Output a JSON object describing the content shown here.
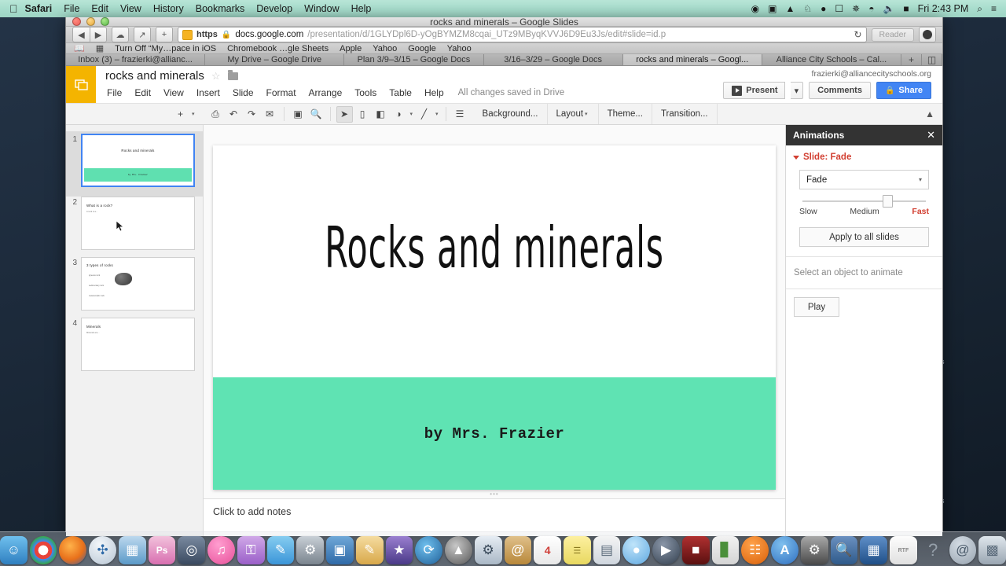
{
  "menubar": {
    "apple_icon": "apple-icon",
    "items": [
      {
        "label": "Safari",
        "bold": true
      },
      {
        "label": "File",
        "bold": false
      },
      {
        "label": "Edit",
        "bold": false
      },
      {
        "label": "View",
        "bold": false
      },
      {
        "label": "History",
        "bold": false
      },
      {
        "label": "Bookmarks",
        "bold": false
      },
      {
        "label": "Develop",
        "bold": false
      },
      {
        "label": "Window",
        "bold": false
      },
      {
        "label": "Help",
        "bold": false
      }
    ],
    "status_icons": [
      "record-icon",
      "screen-share-icon",
      "airdrop-icon",
      "evernote-icon",
      "app-icon",
      "airplay-icon",
      "bluetooth-icon",
      "wifi-icon",
      "volume-icon",
      "battery-icon"
    ],
    "clock": "Fri 2:43 PM",
    "spotlight_icon": "search-icon",
    "notifications_icon": "notification-center-icon"
  },
  "window": {
    "title": "rocks and minerals – Google Slides"
  },
  "browser": {
    "back_icon": "back-arrow-icon",
    "forward_icon": "forward-arrow-icon",
    "icloud_icon": "icloud-tabs-icon",
    "share_icon": "share-icon",
    "newtab_icon": "plus-icon",
    "url": {
      "scheme_label": "https",
      "lock_icon": "lock-icon",
      "host": "docs.google.com",
      "path": "/presentation/d/1GLYDpl6D-yOgBYMZM8cqai_UTz9MByqKVVJ6D9Eu3Js/edit#slide=id.p"
    },
    "reload_icon": "reload-icon",
    "reader_label": "Reader",
    "downloads_icon": "downloads-icon",
    "bookmarks": {
      "reading_list_icon": "reading-list-icon",
      "top_sites_icon": "top-sites-icon",
      "items": [
        "Turn Off “My…pace in iOS",
        "Chromebook …gle Sheets",
        "Apple",
        "Yahoo",
        "Google",
        "Yahoo"
      ]
    },
    "tabs": [
      {
        "label": "Inbox (3) – frazierki@allianc...",
        "active": false
      },
      {
        "label": "My Drive – Google Drive",
        "active": false
      },
      {
        "label": "Plan 3/9–3/15 – Google Docs",
        "active": false
      },
      {
        "label": "3/16–3/29 – Google Docs",
        "active": false
      },
      {
        "label": "rocks and minerals – Googl...",
        "active": true
      },
      {
        "label": "Alliance City Schools – Cal...",
        "active": false
      }
    ],
    "new_tab_icon": "plus-icon",
    "show_all_tabs_icon": "show-all-tabs-icon"
  },
  "slides": {
    "app_logo_icon": "google-slides-icon",
    "doc_title": "rocks and minerals",
    "star_icon": "star-icon",
    "folder_icon": "folder-icon",
    "menus": [
      "File",
      "Edit",
      "View",
      "Insert",
      "Slide",
      "Format",
      "Arrange",
      "Tools",
      "Table",
      "Help"
    ],
    "save_status": "All changes saved in Drive",
    "account": "frazierki@alliancecityschools.org",
    "present_label": "Present",
    "comments_label": "Comments",
    "share_label": "Share",
    "toolbar": {
      "new_slide_icon": "plus-icon",
      "print_icon": "print-icon",
      "undo_icon": "undo-icon",
      "redo_icon": "redo-icon",
      "paint_format_icon": "paint-format-icon",
      "fit_icon": "fit-to-window-icon",
      "zoom_icon": "zoom-icon",
      "select_icon": "select-arrow-icon",
      "textbox_icon": "text-box-icon",
      "image_icon": "image-icon",
      "shape_icon": "shape-icon",
      "line_icon": "line-icon",
      "layout_icon": "layout-icon",
      "background_label": "Background...",
      "layout_label": "Layout",
      "theme_label": "Theme...",
      "transition_label": "Transition...",
      "collapse_icon": "collapse-chevron-icon"
    },
    "filmstrip": [
      {
        "number": "1",
        "title": "Rocks and minerals",
        "band_text": "by Mrs. Frazier",
        "active": true
      },
      {
        "number": "2",
        "title": "What is a rock?",
        "subtitle": "A rock is a...",
        "active": false
      },
      {
        "number": "3",
        "title": "3 types of rocks",
        "bullets": [
          "igneous rock",
          "sedimentary rock",
          "metamorphic rock"
        ],
        "active": false
      },
      {
        "number": "4",
        "title": "Minerals",
        "subtitle": "Minerals are...",
        "active": false
      }
    ],
    "canvas": {
      "slide_title": "Rocks and minerals",
      "slide_subtitle": "by Mrs. Frazier",
      "band_color": "#5fe3b3"
    },
    "notes_placeholder": "Click to add notes"
  },
  "animations": {
    "panel_title": "Animations",
    "close_icon": "close-icon",
    "slide_section_label": "Slide: Fade",
    "effect_value": "Fade",
    "dropdown_icon": "chevron-down-icon",
    "speed_labels": {
      "slow": "Slow",
      "medium": "Medium",
      "fast": "Fast"
    },
    "speed_value": "Fast",
    "apply_all_label": "Apply to all slides",
    "empty_message": "Select an object to animate",
    "play_label": "Play",
    "accent_color": "#d23f31"
  },
  "dock": {
    "items": [
      {
        "name": "finder",
        "glyph": "🙂",
        "color": "#3b9ae1"
      },
      {
        "name": "chrome",
        "glyph": "◉",
        "color": "#ffffff"
      },
      {
        "name": "firefox",
        "glyph": "◐",
        "color": "#e8701a"
      },
      {
        "name": "safari",
        "glyph": "✴",
        "color": "#d8dde2"
      },
      {
        "name": "launchpad",
        "glyph": "▒",
        "color": "#8fb9d9"
      },
      {
        "name": "photoshop",
        "glyph": "Ps",
        "color": "#d86fb0"
      },
      {
        "name": "photo-booth",
        "glyph": "◎",
        "color": "#4a5a73"
      },
      {
        "name": "itunes",
        "glyph": "♫",
        "color": "#f06eb0"
      },
      {
        "name": "keychain",
        "glyph": "⚿",
        "color": "#b06fd8"
      },
      {
        "name": "notes-app",
        "glyph": "✎",
        "color": "#5bb3e8"
      },
      {
        "name": "system-prefs-old",
        "glyph": "⚙",
        "color": "#9aa3ad"
      },
      {
        "name": "keynote",
        "glyph": "▣",
        "color": "#3b7fc4"
      },
      {
        "name": "pages",
        "glyph": "✍",
        "color": "#e8b84a"
      },
      {
        "name": "imovie",
        "glyph": "★",
        "color": "#6a4fa8"
      },
      {
        "name": "time-machine",
        "glyph": "⟳",
        "color": "#2f7fb8"
      },
      {
        "name": "rocket",
        "glyph": "↑",
        "color": "#6e6e6e"
      },
      {
        "name": "preview",
        "glyph": "⚑",
        "color": "#c8d4e0"
      },
      {
        "name": "contacts",
        "glyph": "@",
        "color": "#c79a52"
      },
      {
        "name": "calendar",
        "glyph": "4",
        "color": "#ffffff"
      },
      {
        "name": "stickies",
        "glyph": "☰",
        "color": "#f2e06a"
      },
      {
        "name": "dictionary",
        "glyph": "▤",
        "color": "#e3e3e3"
      },
      {
        "name": "messages",
        "glyph": "●",
        "color": "#7fc4f0"
      },
      {
        "name": "facetime",
        "glyph": "▶",
        "color": "#4a5a73"
      },
      {
        "name": "final-cut",
        "glyph": "■",
        "color": "#8a2020"
      },
      {
        "name": "numbers",
        "glyph": "▐",
        "color": "#5fb84a"
      },
      {
        "name": "ibooks",
        "glyph": "◗",
        "color": "#e8751a"
      },
      {
        "name": "app-store",
        "glyph": "A",
        "color": "#3b8fd8"
      },
      {
        "name": "system-preferences",
        "glyph": "⚙",
        "color": "#6a6a6a"
      },
      {
        "name": "finder-folder",
        "glyph": "🔍",
        "color": "#3b6ea8"
      },
      {
        "name": "downloads-folder",
        "glyph": "▦",
        "color": "#2f6aa8"
      },
      {
        "name": "rtf-document",
        "glyph": "RTF",
        "color": "#f4f4f4"
      },
      {
        "name": "help-question",
        "glyph": "?",
        "color": "#555f6a"
      },
      {
        "name": "at-icon",
        "glyph": "@",
        "color": "#aab4be"
      },
      {
        "name": "trash",
        "glyph": "▥",
        "color": "#c8d0d8"
      }
    ]
  },
  "desktop": {
    "partial_labels": [
      "s",
      "s"
    ]
  }
}
